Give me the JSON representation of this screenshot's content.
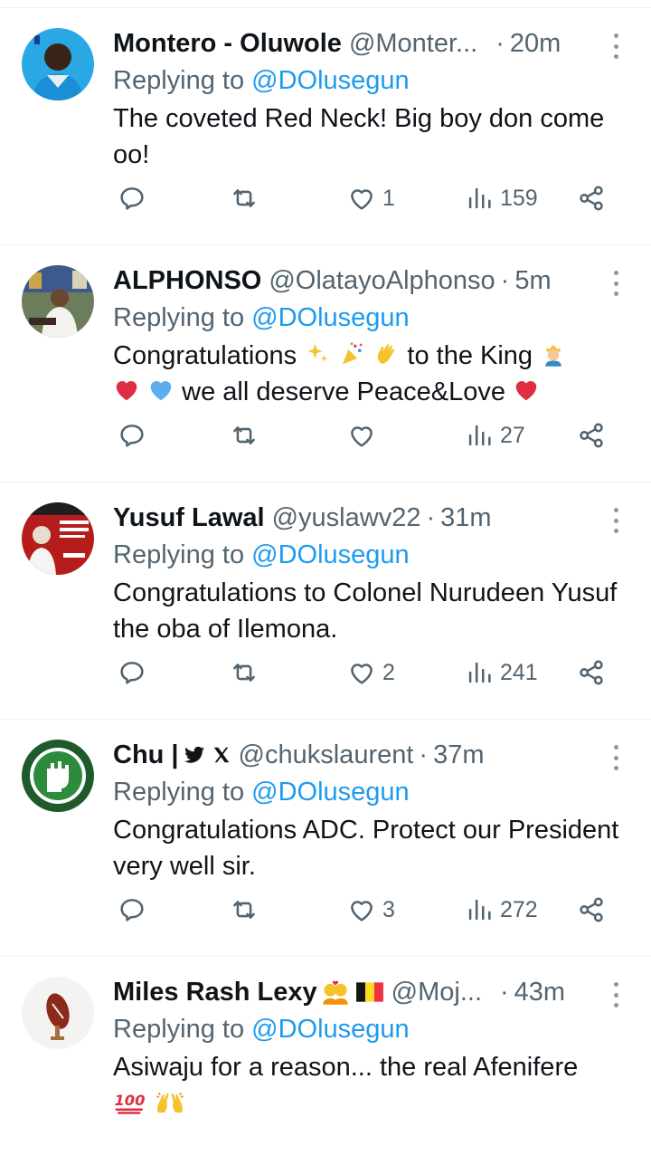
{
  "tweets": [
    {
      "name": "Montero - Oluwole",
      "handle": "@Monter...",
      "time": "20m",
      "replying_prefix": "Replying to",
      "mention": "@DOlusegun",
      "text": "The coveted Red Neck! Big boy don come oo!",
      "likes": "1",
      "views": "159"
    },
    {
      "name": "ALPHONSO",
      "handle": "@OlatayoAlphonso",
      "time": "5m",
      "replying_prefix": "Replying to",
      "mention": "@DOlusegun",
      "text_1": "Congratulations",
      "text_2": "to the King",
      "text_3": "we all deserve Peace&Love",
      "likes": "",
      "views": "27"
    },
    {
      "name": "Yusuf Lawal",
      "handle": "@yuslawv22",
      "time": "31m",
      "replying_prefix": "Replying to",
      "mention": "@DOlusegun",
      "text": "Congratulations to Colonel Nurudeen Yusuf the oba of Ilemona.",
      "likes": "2",
      "views": "241"
    },
    {
      "name": "Chu |",
      "handle": "@chukslaurent",
      "time": "37m",
      "replying_prefix": "Replying to",
      "mention": "@DOlusegun",
      "text": "Congratulations ADC. Protect our President very well sir.",
      "likes": "3",
      "views": "272"
    },
    {
      "name": "Miles Rash Lexy",
      "handle": "@Moj...",
      "time": "43m",
      "replying_prefix": "Replying to",
      "mention": "@DOlusegun",
      "text": "Asiwaju for a reason... the real Afenifere",
      "likes": "",
      "views": ""
    }
  ],
  "separator": "·",
  "icons": {
    "reply": "reply-icon",
    "retweet": "retweet-icon",
    "like": "heart-icon",
    "views": "views-icon",
    "share": "share-icon",
    "more": "more-vertical-icon"
  },
  "colors": {
    "name": "#0f1419",
    "secondary": "#536471",
    "link": "#1d9bf0",
    "divider": "#eff3f4"
  }
}
